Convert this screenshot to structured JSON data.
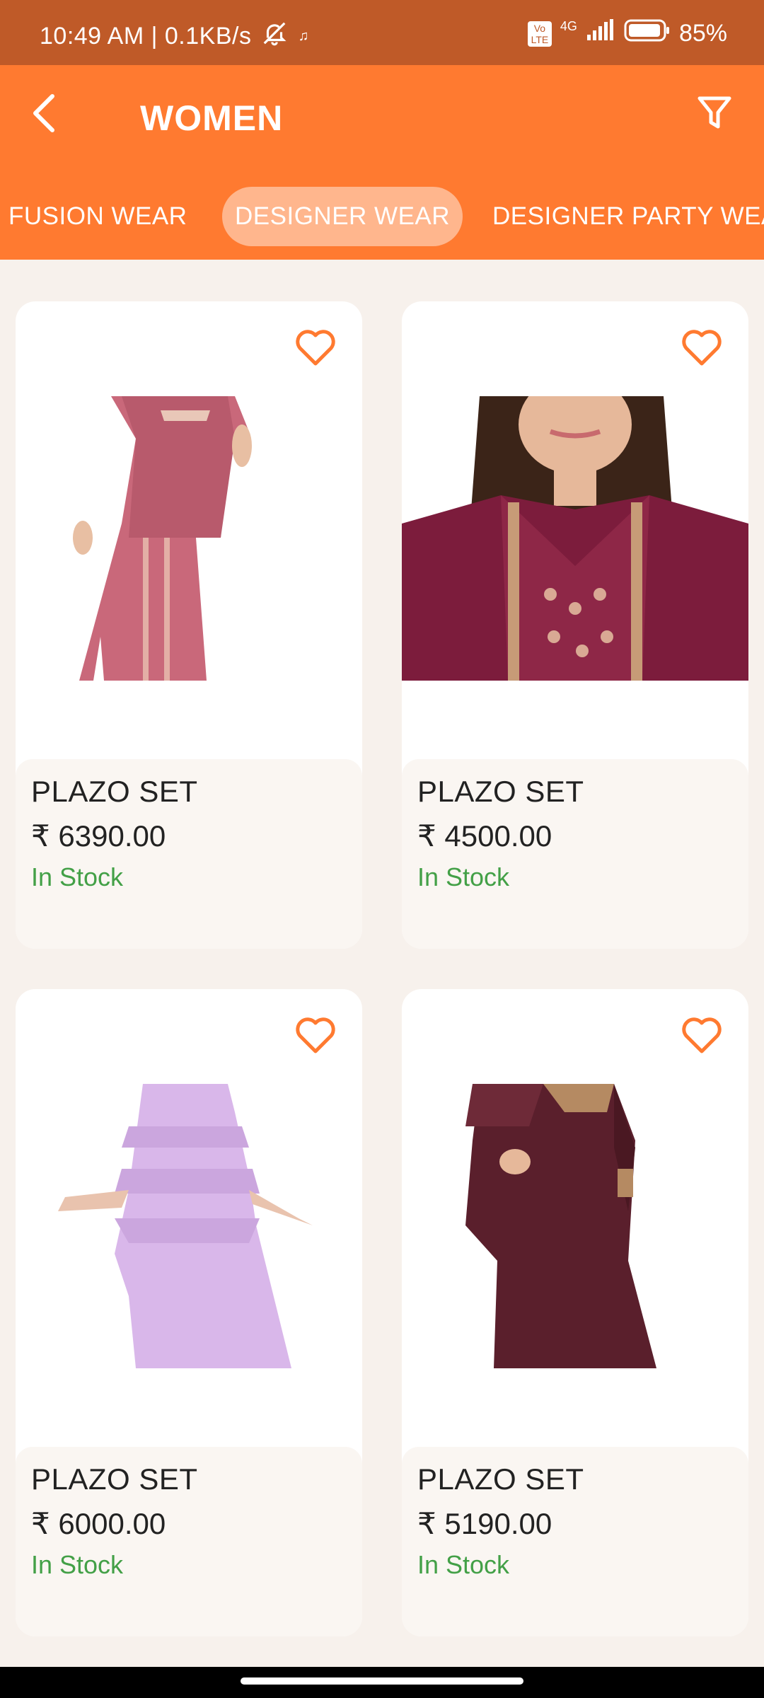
{
  "status_bar": {
    "time_speed": "10:49 AM | 0.1KB/s",
    "network": "4G",
    "volte": "Vo LTE",
    "battery": "85%"
  },
  "header": {
    "title": "WOMEN",
    "back_icon": "back-arrow-icon",
    "filter_icon": "filter-icon"
  },
  "tabs": [
    {
      "label": "FUSION WEAR"
    },
    {
      "label": "DESIGNER WEAR",
      "active": true
    },
    {
      "label": "DESIGNER PARTY WEA"
    }
  ],
  "products": [
    {
      "name": "PLAZO SET",
      "price": "₹ 6390.00",
      "stock": "In Stock"
    },
    {
      "name": "PLAZO SET",
      "price": "₹ 4500.00",
      "stock": "In Stock"
    },
    {
      "name": "PLAZO SET",
      "price": "₹ 6000.00",
      "stock": "In Stock"
    },
    {
      "name": "PLAZO SET",
      "price": "₹ 5190.00",
      "stock": "In Stock"
    }
  ],
  "colors": {
    "status_bar": "#BF5A28",
    "accent": "#FF7A30",
    "in_stock": "#43A047",
    "background": "#F7F1EC"
  }
}
